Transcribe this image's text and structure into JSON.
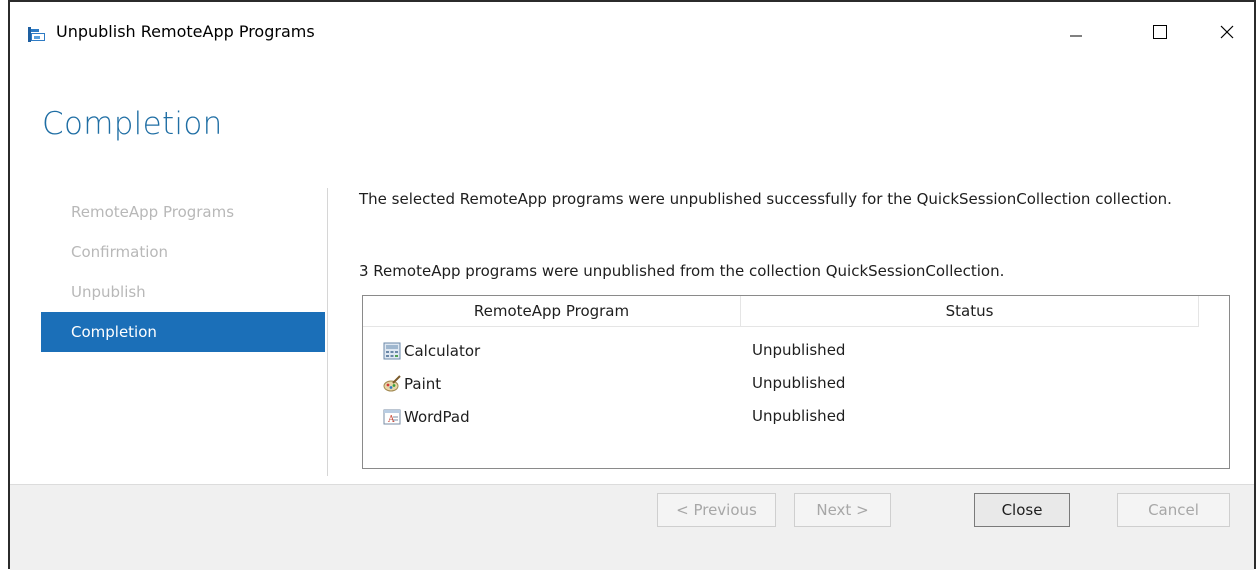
{
  "window": {
    "title": "Unpublish RemoteApp Programs",
    "controls": [
      "minimize-icon",
      "maximize-icon",
      "close-icon"
    ]
  },
  "page": {
    "heading": "Completion"
  },
  "nav": {
    "items": [
      {
        "label": "RemoteApp Programs",
        "state": "inactive"
      },
      {
        "label": "Confirmation",
        "state": "inactive"
      },
      {
        "label": "Unpublish",
        "state": "inactive"
      },
      {
        "label": "Completion",
        "state": "active"
      }
    ]
  },
  "content": {
    "message": "The selected RemoteApp programs were unpublished successfully for the QuickSessionCollection collection.",
    "summary": "3 RemoteApp programs were unpublished from the collection QuickSessionCollection."
  },
  "table": {
    "columns": [
      "RemoteApp Program",
      "Status"
    ],
    "rows": [
      {
        "program": "Calculator",
        "icon": "calculator-icon",
        "status": "Unpublished"
      },
      {
        "program": "Paint",
        "icon": "paint-icon",
        "status": "Unpublished"
      },
      {
        "program": "WordPad",
        "icon": "wordpad-icon",
        "status": "Unpublished"
      }
    ]
  },
  "buttons": {
    "previous": "< Previous",
    "next": "Next >",
    "close": "Close",
    "cancel": "Cancel"
  },
  "colors": {
    "accent": "#1b6fb8",
    "heading": "#1f6ea4",
    "disabled_text": "#a7a7a7",
    "nav_inactive": "#b8b8b8",
    "footer_bg": "#f0f0f0"
  }
}
